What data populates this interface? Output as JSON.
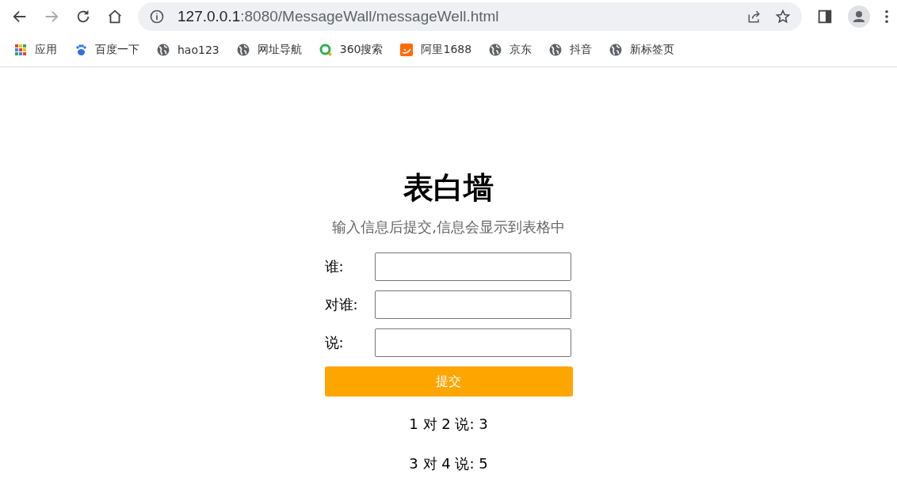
{
  "toolbar": {
    "back_disabled": false,
    "forward_disabled": true,
    "address": {
      "host": "127.0.0.1",
      "path": ":8080/MessageWall/messageWell.html"
    }
  },
  "bookmarks": [
    {
      "label": "应用",
      "kind": "apps"
    },
    {
      "label": "百度一下",
      "kind": "paw"
    },
    {
      "label": "hao123",
      "kind": "globe"
    },
    {
      "label": "网址导航",
      "kind": "globe"
    },
    {
      "label": "360搜索",
      "kind": "ring"
    },
    {
      "label": "阿里1688",
      "kind": "orange"
    },
    {
      "label": "京东",
      "kind": "globe"
    },
    {
      "label": "抖音",
      "kind": "globe"
    },
    {
      "label": "新标签页",
      "kind": "globe"
    }
  ],
  "page": {
    "title": "表白墙",
    "subtitle": "输入信息后提交,信息会显示到表格中",
    "fields": [
      {
        "label": "谁:"
      },
      {
        "label": "对谁:"
      },
      {
        "label": "说:"
      }
    ],
    "submit": "提交",
    "messages": [
      "1 对 2 说: 3",
      "3 对 4 说: 5"
    ]
  }
}
